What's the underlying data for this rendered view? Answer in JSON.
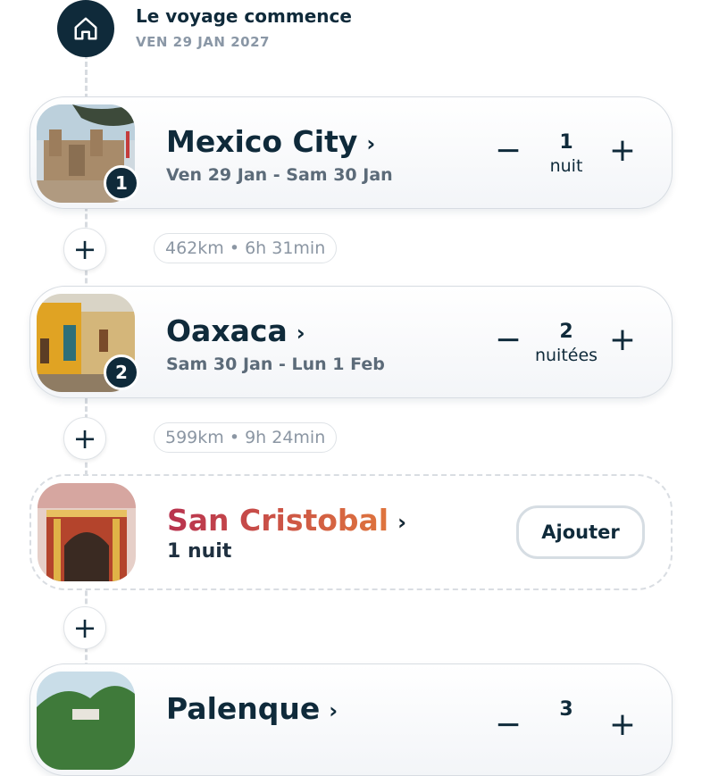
{
  "trip_start": {
    "title": "Le voyage commence",
    "date": "VEN 29 JAN 2027",
    "icon": "home-icon"
  },
  "stops": [
    {
      "name": "Mexico City",
      "dates": "Ven 29 Jan - Sam 30 Jan",
      "badge": "1",
      "nights_count": "1",
      "nights_label": "nuit"
    },
    {
      "name": "Oaxaca",
      "dates": "Sam 30 Jan - Lun 1 Feb",
      "badge": "2",
      "nights_count": "2",
      "nights_label": "nuitées"
    },
    {
      "name": "San Cristobal",
      "subtitle": "1 nuit",
      "add_label": "Ajouter"
    },
    {
      "name": "Palenque",
      "nights_count": "3"
    }
  ],
  "legs": [
    {
      "distance": "462km • 6h 31min"
    },
    {
      "distance": "599km • 9h 24min"
    }
  ],
  "controls": {
    "minus": "−",
    "plus": "+",
    "chevron": "›",
    "add_stop": "+"
  },
  "colors": {
    "primary": "#0f2a3a",
    "muted": "#8a97a6",
    "suggestion_gradient_start": "#b8324f",
    "suggestion_gradient_end": "#e27a3c"
  }
}
